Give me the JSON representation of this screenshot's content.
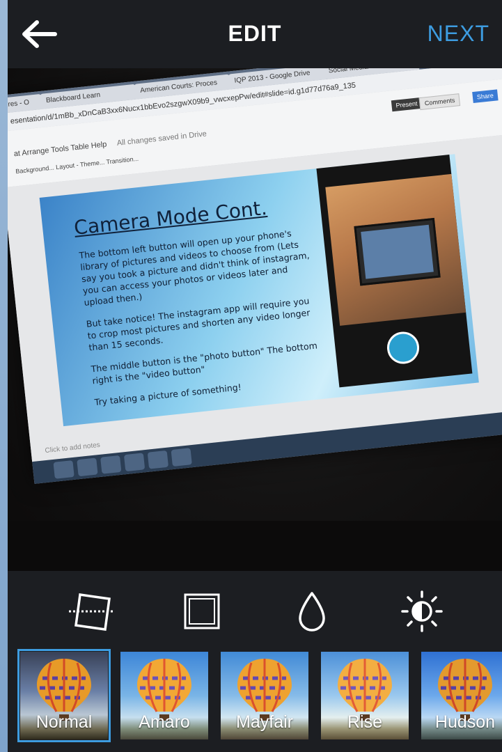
{
  "header": {
    "title": "EDIT",
    "next_label": "NEXT",
    "back_icon": "arrow-left-icon"
  },
  "photo": {
    "browser_tabs": [
      "ndres - O",
      "Blackboard Learn",
      "American Courts: Proces",
      "IQP 2013 - Google Drive",
      "Social Media Tutorial - Go"
    ],
    "url": "esentation/d/1mBb_xDnCaB3xx6Nucx1bbEvo2szgwX09b9_vwcxepPw/edit#slide=id.g1d77d76a9_135",
    "menu": "at   Arrange   Tools   Table   Help",
    "saved_status": "All changes saved in Drive",
    "toolbar": "Background...   Layout -   Theme...   Transition...",
    "present_label": "Present",
    "comments_label": "Comments",
    "share_label": "Share",
    "slide_title": "Camera Mode Cont.",
    "slide_paragraphs": [
      "The bottom left button will open up your phone's library of pictures and videos to choose from (Lets say you took a picture and didn't think of instagram, you can access your photos or videos later and upload then.)",
      "But take notice! The instagram app will require you to crop most pictures and shorten any video longer than 15 seconds.",
      "The middle button is the \"photo button\" The bottom right is the \"video button\"",
      "Try taking a picture of something!"
    ],
    "notes_placeholder": "Click to add notes"
  },
  "tools": [
    {
      "name": "straighten-icon"
    },
    {
      "name": "border-frame-icon"
    },
    {
      "name": "drop-icon"
    },
    {
      "name": "brightness-icon"
    }
  ],
  "filters": [
    {
      "label": "Normal",
      "selected": true
    },
    {
      "label": "Amaro",
      "selected": false
    },
    {
      "label": "Mayfair",
      "selected": false
    },
    {
      "label": "Rise",
      "selected": false
    },
    {
      "label": "Hudson",
      "selected": false
    }
  ],
  "colors": {
    "accent": "#3d9ce0",
    "background": "#1c1e22",
    "text": "#ffffff"
  }
}
